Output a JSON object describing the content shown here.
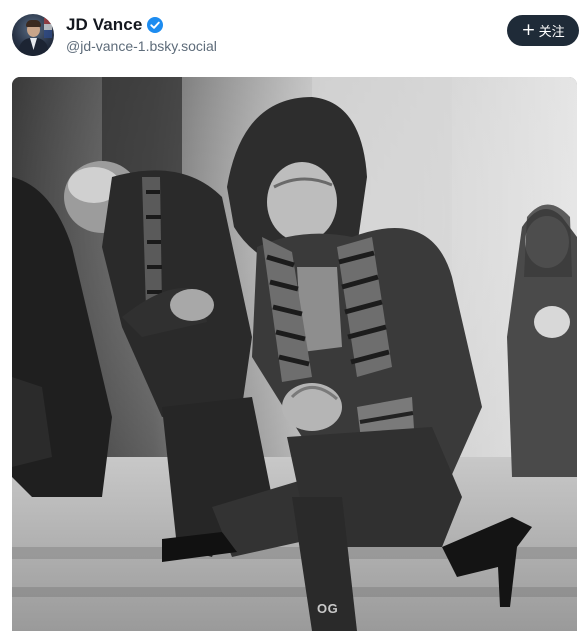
{
  "post": {
    "author": {
      "display_name": "JD Vance",
      "handle": "@jd-vance-1.bsky.social",
      "verified": true,
      "avatar_icon": "avatar-portrait"
    },
    "follow_button": {
      "icon": "plus-icon",
      "icon_glyph": "+",
      "label": "关注"
    },
    "media": {
      "type": "photo",
      "style": "black-and-white",
      "watermark": "OG"
    }
  },
  "colors": {
    "follow_button_bg": "#1f2b38",
    "verified_badge": "#1d8cf0",
    "name_text": "#14181f",
    "handle_text": "#5e6c7a"
  }
}
